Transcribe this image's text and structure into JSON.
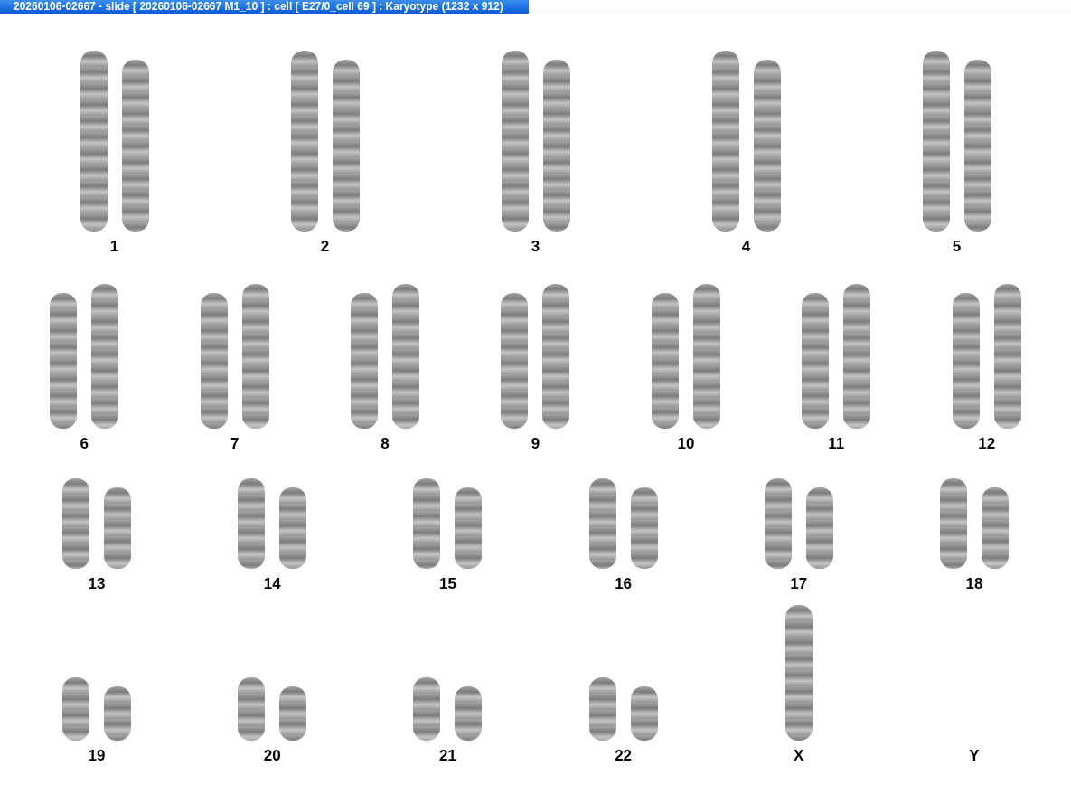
{
  "window": {
    "title": "20260106-02667 - slide [ 20260106-02667 M1_10 ] : cell [ E27/0_cell 69 ] : Karyotype  (1232 x 912)"
  },
  "rows": [
    {
      "items": [
        {
          "label": "1",
          "kind": "pair"
        },
        {
          "label": "2",
          "kind": "pair"
        },
        {
          "label": "3",
          "kind": "pair"
        },
        {
          "label": "4",
          "kind": "pair"
        },
        {
          "label": "5",
          "kind": "pair"
        }
      ]
    },
    {
      "items": [
        {
          "label": "6",
          "kind": "pair"
        },
        {
          "label": "7",
          "kind": "pair"
        },
        {
          "label": "8",
          "kind": "pair"
        },
        {
          "label": "9",
          "kind": "pair"
        },
        {
          "label": "10",
          "kind": "pair"
        },
        {
          "label": "11",
          "kind": "pair"
        },
        {
          "label": "12",
          "kind": "pair"
        }
      ]
    },
    {
      "items": [
        {
          "label": "13",
          "kind": "pair"
        },
        {
          "label": "14",
          "kind": "pair"
        },
        {
          "label": "15",
          "kind": "pair"
        },
        {
          "label": "16",
          "kind": "pair"
        },
        {
          "label": "17",
          "kind": "pair"
        },
        {
          "label": "18",
          "kind": "pair"
        }
      ]
    },
    {
      "items": [
        {
          "label": "19",
          "kind": "pair"
        },
        {
          "label": "20",
          "kind": "pair"
        },
        {
          "label": "21",
          "kind": "pair"
        },
        {
          "label": "22",
          "kind": "pair"
        },
        {
          "label": "X",
          "kind": "single"
        },
        {
          "label": "Y",
          "kind": "none"
        }
      ]
    }
  ]
}
